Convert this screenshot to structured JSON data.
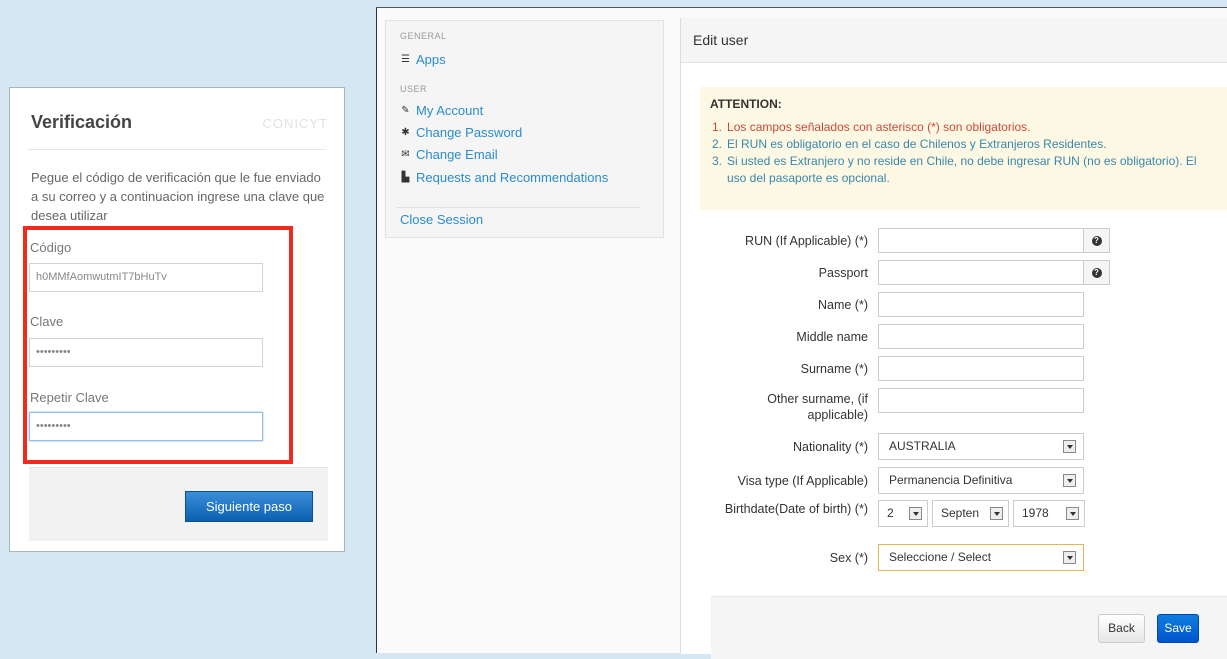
{
  "verification": {
    "title": "Verificación",
    "logo": "CONICYT",
    "description": "Pegue el código de verificación que le fue enviado a su correo y a continuacion ingrese una clave que desea utilizar",
    "codigo_label": "Código",
    "codigo_value": "h0MMfAomwutmIT7bHuTv",
    "clave_label": "Clave",
    "clave_value": "•••••••••",
    "repetir_label": "Repetir Clave",
    "repetir_value": "•••••••••",
    "next_button": "Siguiente paso"
  },
  "sidebar": {
    "general_heading": "GENERAL",
    "apps": "Apps",
    "user_heading": "USER",
    "my_account": "My Account",
    "change_password": "Change Password",
    "change_email": "Change Email",
    "requests": "Requests and Recommendations",
    "close_session": "Close Session"
  },
  "panel": {
    "title": "Edit user"
  },
  "attention": {
    "title": "ATTENTION:",
    "items": [
      {
        "num": "1.",
        "text": "Los campos señalados con asterisco (*) son obligatorios."
      },
      {
        "num": "2.",
        "text": "El RUN es obligatorio en el caso de Chilenos y Extranjeros Residentes."
      },
      {
        "num": "3.",
        "text": "Si usted es Extranjero y no reside en Chile, no debe ingresar RUN (no es obligatorio). El uso del pasaporte es opcional."
      }
    ]
  },
  "form": {
    "run_label": "RUN (If Applicable) (*)",
    "passport_label": "Passport",
    "name_label": "Name (*)",
    "middle_label": "Middle name",
    "surname_label": "Surname (*)",
    "other_surname_label": "Other surname, (if applicable)",
    "nationality_label": "Nationality (*)",
    "nationality_value": "AUSTRALIA",
    "visa_label": "Visa type (If Applicable)",
    "visa_value": "Permanencia Definitiva",
    "birth_label": "Birthdate(Date of birth) (*)",
    "birth_day": "2",
    "birth_month": "Septen",
    "birth_year": "1978",
    "sex_label": "Sex (*)",
    "sex_value": "Seleccione / Select",
    "back_button": "Back",
    "save_button": "Save"
  }
}
